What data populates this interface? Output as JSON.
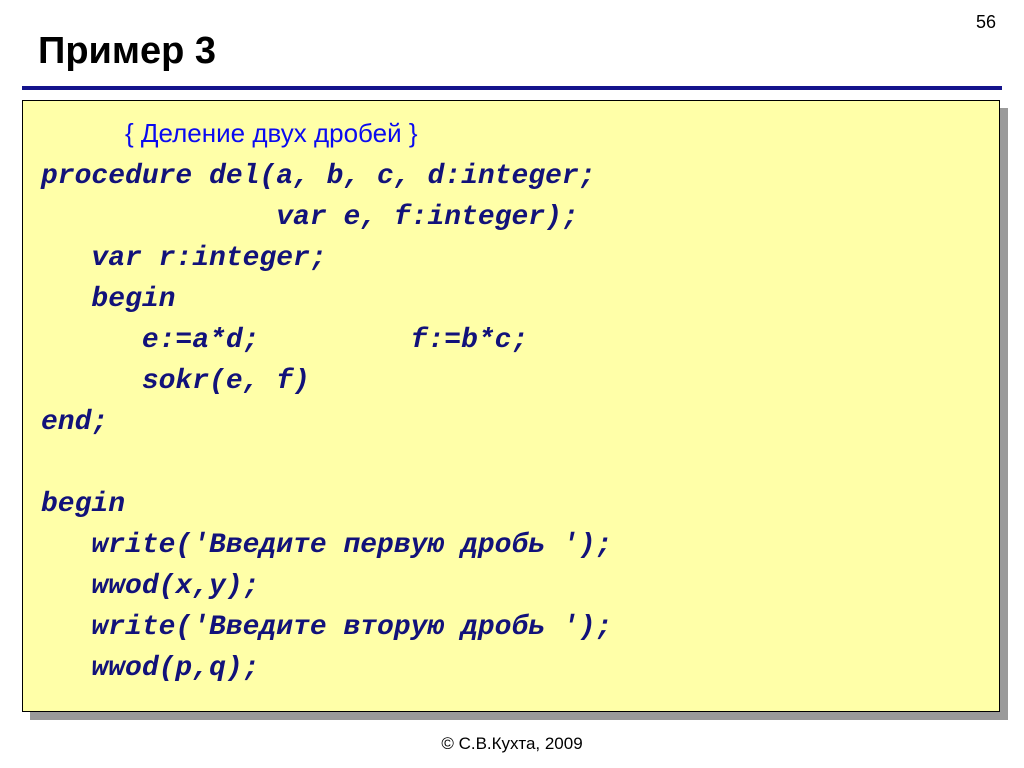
{
  "page_number": "56",
  "title": "Пример 3",
  "footer": "© С.В.Кухта, 2009",
  "code": {
    "comment_indent": "     ",
    "comment": "{ Деление двух дробей }",
    "l1": "procedure del(a, b, c, d:integer;",
    "l2": "              var e, f:integer);",
    "l3": "   var r:integer;",
    "l4": "   begin",
    "l5": "      e:=a*d;         f:=b*c;",
    "l6": "      sokr(e, f)",
    "l7": "end;",
    "l8": "",
    "l9": "begin",
    "l10": "   write('Введите первую дробь ');",
    "l11": "   wwod(x,y);",
    "l12": "   write('Введите вторую дробь ');",
    "l13": "   wwod(p,q);"
  }
}
